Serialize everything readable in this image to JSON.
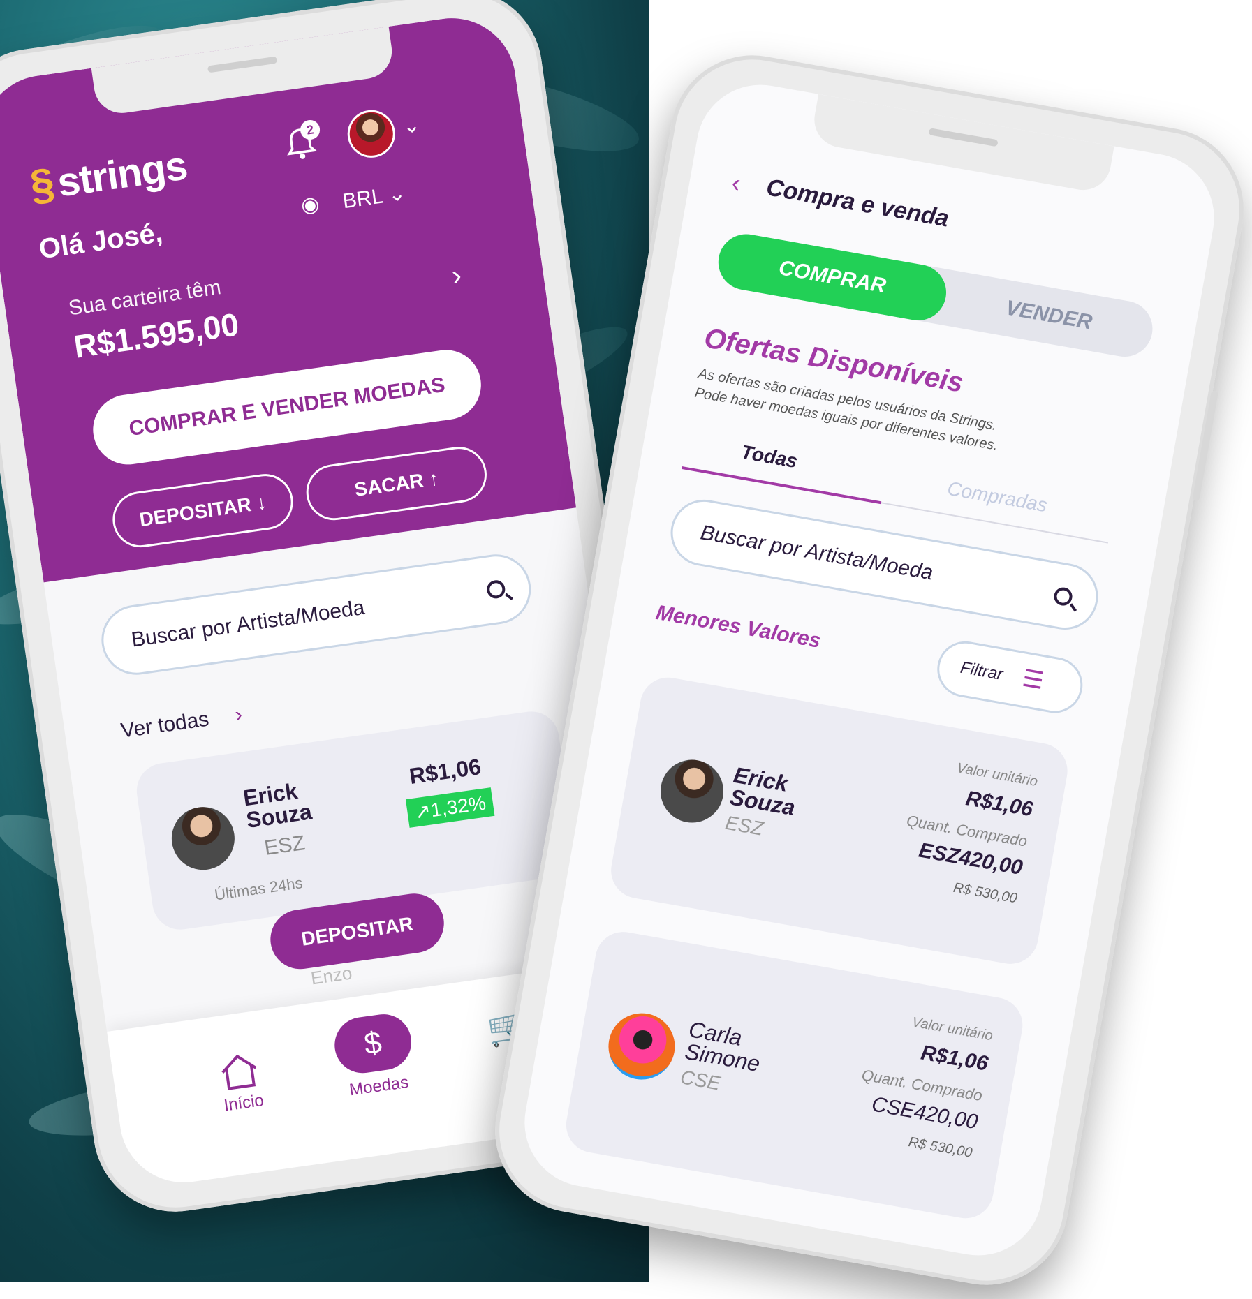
{
  "colors": {
    "brand_purple": "#8f2c93",
    "accent_green": "#22d056",
    "accent_yellow": "#f5b638"
  },
  "home": {
    "logo_text": "strings",
    "notification_count": "2",
    "greeting": "Olá José,",
    "currency": "BRL",
    "wallet_label": "Sua carteira têm",
    "wallet_balance": "R$1.595,00",
    "main_button": "COMPRAR E VENDER MOEDAS",
    "deposit_button": "DEPOSITAR",
    "withdraw_button": "SACAR",
    "search_placeholder": "Buscar por Artista/Moeda",
    "see_all": "Ver todas",
    "coin": {
      "artist_first": "Erick",
      "artist_last": "Souza",
      "ticker": "ESZ",
      "price": "R$1,06",
      "change": "1,32%",
      "period": "Últimas 24hs"
    },
    "floating_button": "DEPOSITAR",
    "peek_name": "Enzo",
    "nav": {
      "home": "Início",
      "coins": "Moedas"
    }
  },
  "market": {
    "title": "Compra e venda",
    "tab_buy": "COMPRAR",
    "tab_sell": "VENDER",
    "offers_title": "Ofertas Disponíveis",
    "offers_desc_1": "As ofertas são criadas pelos usuários da Strings.",
    "offers_desc_2": "Pode haver moedas iguais por diferentes valores.",
    "subtab_all": "Todas",
    "subtab_bought": "Compradas",
    "search_placeholder": "Buscar por Artista/Moeda",
    "section_title": "Menores Valores",
    "filter_button": "Filtrar",
    "offers": [
      {
        "artist_first": "Erick",
        "artist_last": "Souza",
        "ticker": "ESZ",
        "unit_label": "Valor unitário",
        "unit_price": "R$1,06",
        "qty_label": "Quant. Comprado",
        "qty": "ESZ420,00",
        "total": "R$ 530,00"
      },
      {
        "artist_first": "Carla",
        "artist_last": "Simone",
        "ticker": "CSE",
        "unit_label": "Valor unitário",
        "unit_price": "R$1,06",
        "qty_label": "Quant. Comprado",
        "qty": "CSE420,00",
        "total": "R$ 530,00"
      }
    ]
  }
}
